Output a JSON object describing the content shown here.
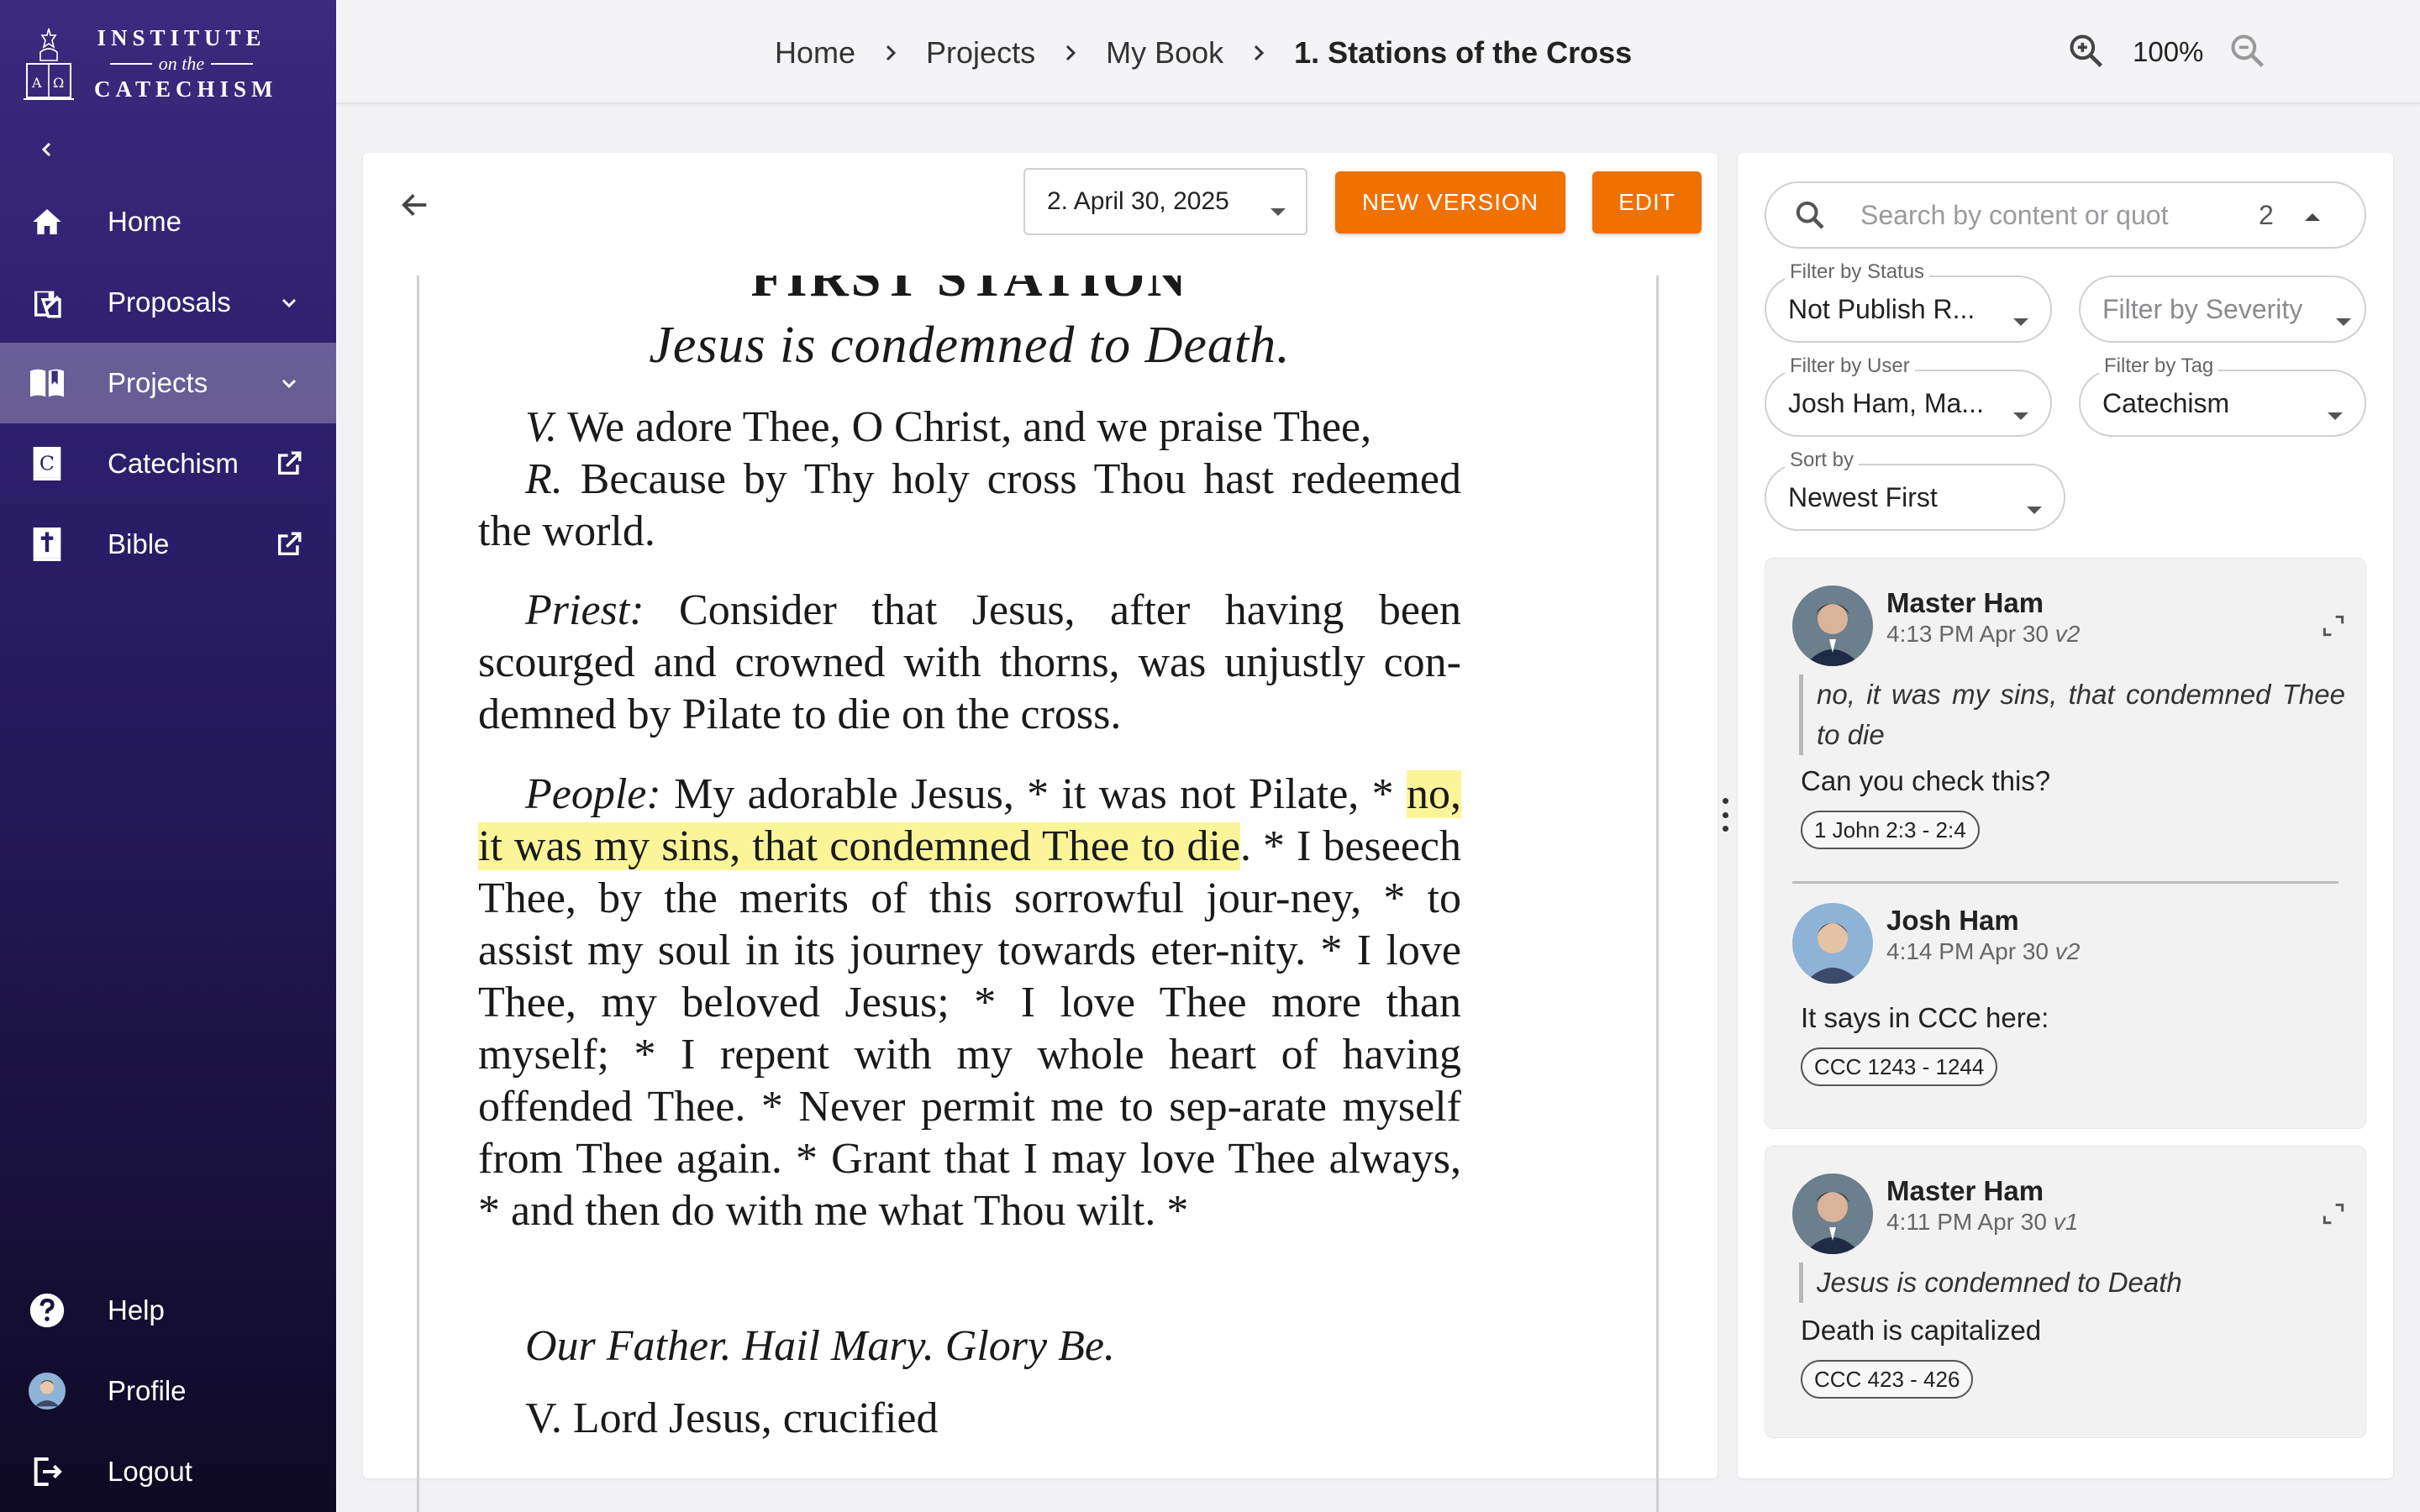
{
  "brand": {
    "line1": "INSTITUTE",
    "line2": "on the",
    "line3": "CATECHISM"
  },
  "sidebar": {
    "collapse_icon": "chevron-left-icon",
    "items": [
      {
        "label": "Home",
        "icon": "home-icon"
      },
      {
        "label": "Proposals",
        "icon": "proposals-icon",
        "trail": "chevron-down-icon"
      },
      {
        "label": "Projects",
        "icon": "book-open-icon",
        "trail": "chevron-down-icon",
        "active": true
      },
      {
        "label": "Catechism",
        "icon": "catechism-book-icon",
        "trail": "external-link-icon"
      },
      {
        "label": "Bible",
        "icon": "bible-icon",
        "trail": "external-link-icon"
      }
    ],
    "bottom": [
      {
        "label": "Help",
        "icon": "help-icon"
      },
      {
        "label": "Profile",
        "icon": "avatar"
      },
      {
        "label": "Logout",
        "icon": "logout-icon"
      }
    ]
  },
  "breadcrumb": [
    "Home",
    "Projects",
    "My Book",
    "1. Stations of the Cross"
  ],
  "zoom": {
    "value": "100%"
  },
  "toolbar": {
    "version": "2. April 30, 2025",
    "new_version": "NEW VERSION",
    "edit": "EDIT"
  },
  "document": {
    "station": "FIRST STATION",
    "subtitle": "Jesus is condemned to Death.",
    "versicle_v": "V.",
    "versicle_text": "We adore Thee, O Christ, and we praise Thee,",
    "response_r": "R.",
    "response_text": "Because by Thy holy cross Thou hast redeemed the world.",
    "priest_label": "Priest:",
    "priest_text": "Consider that Jesus, after having been scourged and crowned with thorns, was unjustly con-demned by Pilate to die on the cross.",
    "people_label": "People:",
    "people_text_1": "My adorable Jesus, * it was not Pilate, *",
    "people_highlight": "no, it was my sins, that condemned Thee to die",
    "people_text_2": ". * I beseech Thee, by the merits of this sorrowful jour-ney, * to assist my soul in its journey towards eter-nity. * I love Thee, my beloved Jesus; * I love Thee more than myself; * I repent with my whole heart of having offended Thee. * Never permit me to sep-arate myself from Thee again. * Grant that I may love Thee always, * and then do with me what Thou wilt. *",
    "prayers": "Our Father. Hail Mary. Glory Be.",
    "next_line": "V. Lord Jesus, crucified"
  },
  "comments_panel": {
    "search_placeholder": "Search by content or quot",
    "match_count": "2",
    "filters": {
      "status": {
        "label": "Filter by Status",
        "value": "Not Publish R..."
      },
      "severity": {
        "label": "",
        "placeholder": "Filter by Severity"
      },
      "user": {
        "label": "Filter by User",
        "value": "Josh Ham, Ma..."
      },
      "tag": {
        "label": "Filter by Tag",
        "value": "Catechism"
      },
      "sort": {
        "label": "Sort by",
        "value": "Newest First"
      }
    },
    "threads": [
      {
        "comments": [
          {
            "author": "Master Ham",
            "time": "4:13 PM Apr 30",
            "version": "v2",
            "quote": "no, it was my sins, that condemned Thee to die",
            "body": "Can you check this?",
            "tag": "1 John 2:3 - 2:4"
          },
          {
            "author": "Josh Ham",
            "time": "4:14 PM Apr 30",
            "version": "v2",
            "quote": "",
            "body": "It says in CCC here:",
            "tag": "CCC 1243 - 1244"
          }
        ]
      },
      {
        "comments": [
          {
            "author": "Master Ham",
            "time": "4:11 PM Apr 30",
            "version": "v1",
            "quote": "Jesus is condemned to Death",
            "body": "Death is capitalized",
            "tag": "CCC 423 - 426"
          }
        ]
      }
    ]
  },
  "colors": {
    "accent": "#f07000",
    "sidebar_top": "#3b2a7d",
    "sidebar_bottom": "#0e0a24",
    "highlight": "#fbf59a"
  }
}
